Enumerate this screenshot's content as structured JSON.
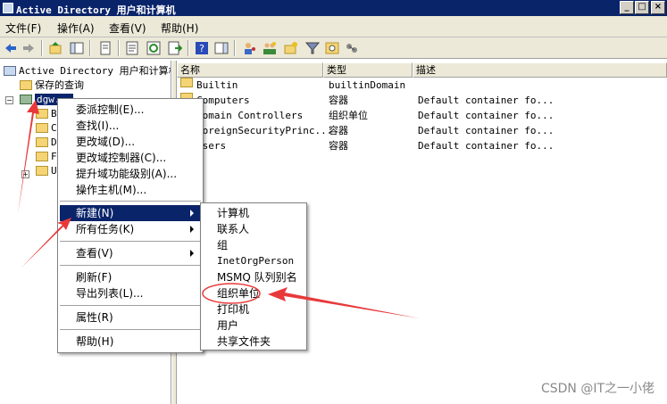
{
  "window": {
    "title": "Active Directory 用户和计算机",
    "minimize_glyph": "_",
    "maximize_glyph": "□",
    "close_glyph": "×"
  },
  "menubar": [
    "文件(F)",
    "操作(A)",
    "查看(V)",
    "帮助(H)"
  ],
  "toolbar": {
    "icons": [
      "back-icon",
      "forward-icon",
      "up-icon",
      "show-hide-console-tree-icon",
      "copy-icon",
      "properties-icon",
      "refresh-icon",
      "export-list-icon",
      "help-icon",
      "show-action-pane-icon",
      "users-icon",
      "new-group-icon",
      "new-ou-icon",
      "filter-icon",
      "find-icon",
      "add-to-group-icon"
    ]
  },
  "tree": {
    "root": "Active Directory 用户和计算机",
    "saved_queries": "保存的查询",
    "domain": "dgw.",
    "children_partial": [
      "B",
      "C",
      "D",
      "F",
      "U"
    ]
  },
  "list": {
    "columns": [
      "名称",
      "类型",
      "描述"
    ],
    "rows": [
      {
        "name": "Builtin",
        "type": "builtinDomain",
        "desc": ""
      },
      {
        "name": "Computers",
        "type": "容器",
        "desc": "Default container fo..."
      },
      {
        "name": "Domain Controllers",
        "type": "组织单位",
        "desc": "Default container fo..."
      },
      {
        "name": "ForeignSecurityPrinc...",
        "type": "容器",
        "desc": "Default container fo..."
      },
      {
        "name": "Users",
        "type": "容器",
        "desc": "Default container fo..."
      }
    ]
  },
  "context_menu": {
    "group1": [
      "委派控制(E)...",
      "查找(I)...",
      "更改域(D)...",
      "更改域控制器(C)...",
      "提升域功能级别(A)...",
      "操作主机(M)..."
    ],
    "new": "新建(N)",
    "all_tasks": "所有任务(K)",
    "view": "查看(V)",
    "refresh": "刷新(F)",
    "export": "导出列表(L)...",
    "properties": "属性(R)",
    "help": "帮助(H)"
  },
  "submenu": {
    "items": [
      "计算机",
      "联系人",
      "组",
      "InetOrgPerson",
      "MSMQ 队列别名",
      "组织单位",
      "打印机",
      "用户",
      "共享文件夹"
    ],
    "highlighted": "组织单位"
  },
  "annotations": {
    "arrow_color": "#e8393a"
  },
  "watermark": "CSDN @IT之一小佬"
}
